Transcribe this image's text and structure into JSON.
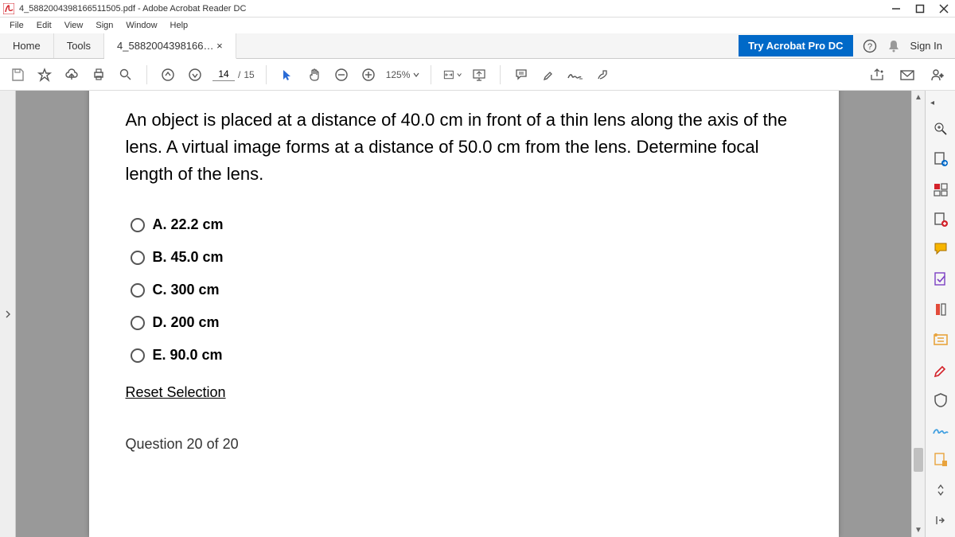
{
  "window": {
    "title": "4_5882004398166511505.pdf - Adobe Acrobat Reader DC"
  },
  "menu": [
    "File",
    "Edit",
    "View",
    "Sign",
    "Window",
    "Help"
  ],
  "tabs": {
    "home": "Home",
    "tools": "Tools",
    "active": "4_5882004398166… ×"
  },
  "tabbar": {
    "try": "Try Acrobat Pro DC",
    "signin": "Sign In"
  },
  "toolbar": {
    "page_current": "14",
    "page_sep": " / ",
    "page_total": "15",
    "zoom": "125%"
  },
  "document": {
    "question": "An object is placed at a distance of 40.0 cm in front of a thin lens along the axis of the lens. A virtual image forms at a distance of 50.0 cm from the lens. Determine focal length of the lens.",
    "options": [
      "A. 22.2 cm",
      "B. 45.0 cm",
      "C. 300 cm",
      "D. 200 cm",
      "E. 90.0 cm"
    ],
    "reset": "Reset Selection",
    "qnum": "Question 20 of 20"
  }
}
